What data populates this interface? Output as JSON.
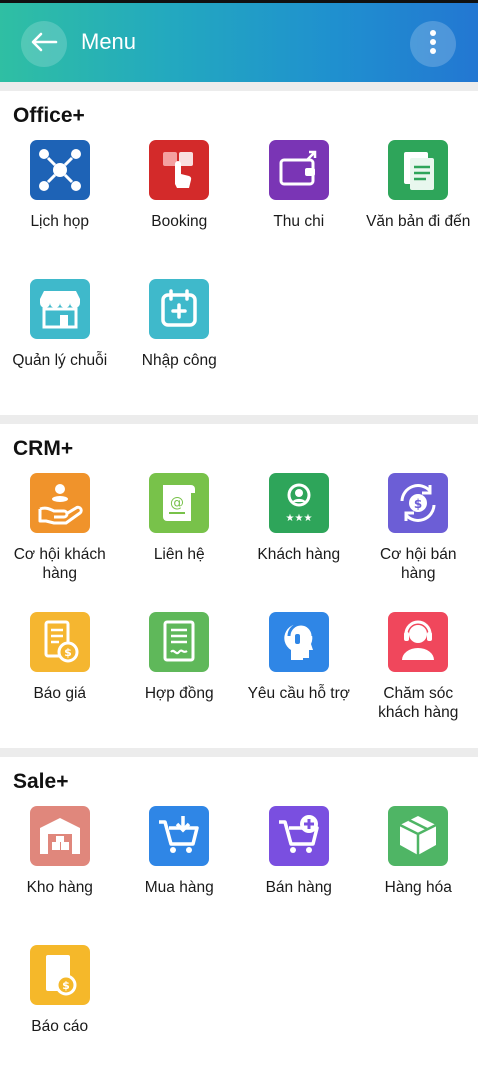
{
  "header": {
    "title": "Menu",
    "back_icon": "arrow-left-icon",
    "more_icon": "more-vertical-icon"
  },
  "sections": [
    {
      "title": "Office+",
      "items": [
        {
          "label": "Lịch họp",
          "icon": "meeting-icon",
          "color": "#1e63b6"
        },
        {
          "label": "Booking",
          "icon": "booking-icon",
          "color": "#d32a2a"
        },
        {
          "label": "Thu chi",
          "icon": "wallet-icon",
          "color": "#7a35b5"
        },
        {
          "label": "Văn bản đi đến",
          "icon": "document-icon",
          "color": "#2ea55a"
        },
        {
          "label": "Quản lý chuỗi",
          "icon": "store-icon",
          "color": "#3fb9cb"
        },
        {
          "label": "Nhập công",
          "icon": "calendar-add-icon",
          "color": "#3fb9cb"
        }
      ]
    },
    {
      "title": "CRM+",
      "items": [
        {
          "label": "Cơ hội khách hàng",
          "icon": "hand-coins-icon",
          "color": "#f0932b"
        },
        {
          "label": "Liên hệ",
          "icon": "contact-scroll-icon",
          "color": "#78c24a"
        },
        {
          "label": "Khách hàng",
          "icon": "customer-icon",
          "color": "#2ea55a"
        },
        {
          "label": "Cơ hội bán hàng",
          "icon": "sales-cycle-icon",
          "color": "#6c5ed6"
        },
        {
          "label": "Báo giá",
          "icon": "quote-icon",
          "color": "#f5b630"
        },
        {
          "label": "Hợp đồng",
          "icon": "contract-icon",
          "color": "#5fb85a"
        },
        {
          "label": "Yêu cầu hỗ trợ",
          "icon": "support-head-icon",
          "color": "#2f86e6"
        },
        {
          "label": "Chăm sóc khách hàng",
          "icon": "customer-care-icon",
          "color": "#f0475c"
        }
      ]
    },
    {
      "title": "Sale+",
      "items": [
        {
          "label": "Kho hàng",
          "icon": "warehouse-icon",
          "color": "#e0877c"
        },
        {
          "label": "Mua hàng",
          "icon": "cart-down-icon",
          "color": "#2f86e6"
        },
        {
          "label": "Bán hàng",
          "icon": "cart-plus-icon",
          "color": "#7a4fe0"
        },
        {
          "label": "Hàng hóa",
          "icon": "box-icon",
          "color": "#4fb565"
        },
        {
          "label": "Báo cáo",
          "icon": "report-icon",
          "color": "#f5b82a"
        }
      ]
    }
  ]
}
